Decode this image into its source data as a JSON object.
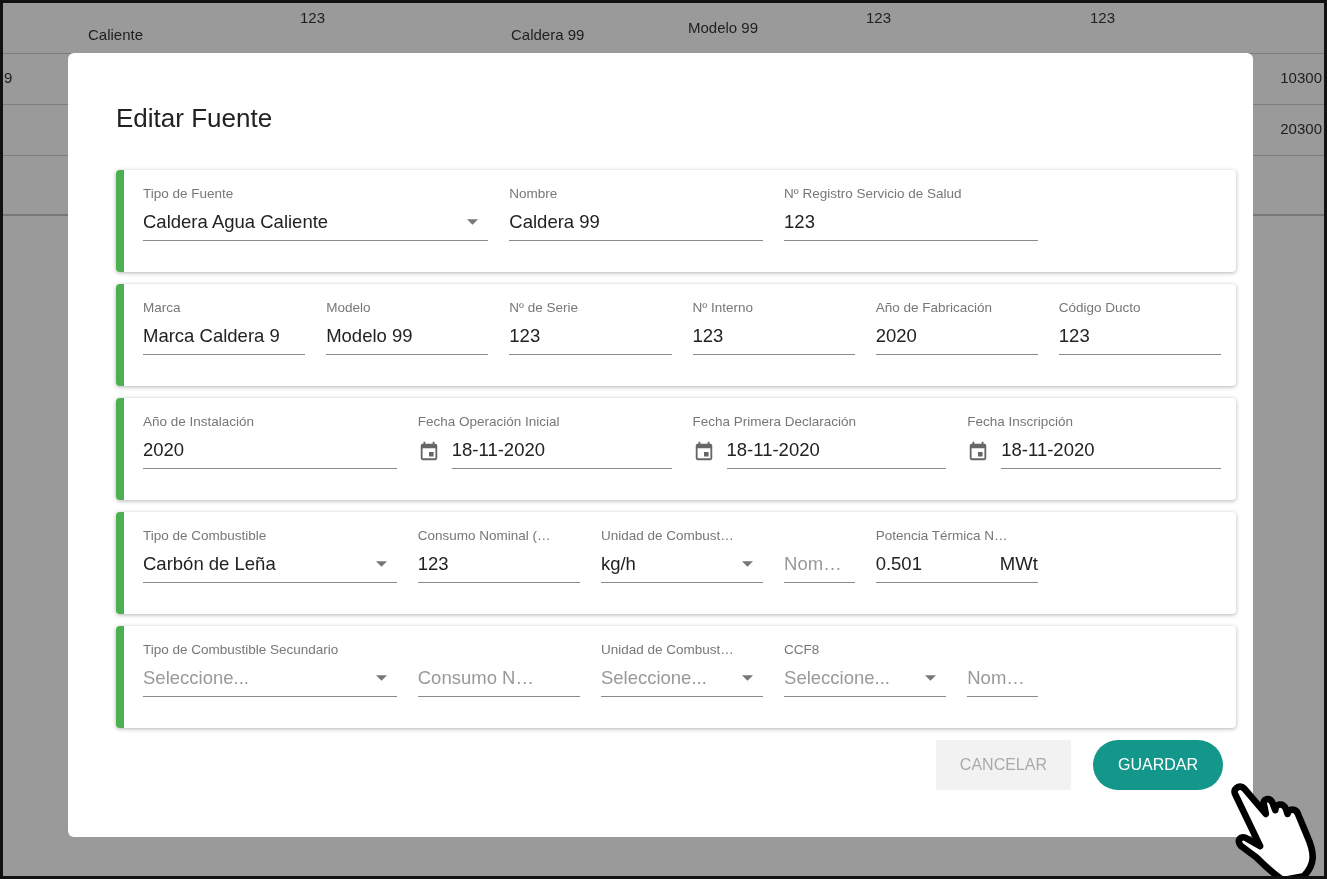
{
  "background_table": {
    "rows": [
      {
        "cells": [
          "Caliente",
          "123",
          "Caldera 99",
          "Modelo 99",
          "123",
          "123"
        ]
      },
      {
        "start": "9",
        "end": "10300"
      },
      {
        "end": "20300"
      },
      {}
    ]
  },
  "dialog": {
    "title": "Editar Fuente",
    "cards": [
      {
        "fields": [
          {
            "kind": "select",
            "label": "Tipo de Fuente",
            "value": "Caldera Agua Caliente"
          },
          {
            "kind": "text",
            "label": "Nombre",
            "value": "Caldera 99"
          },
          {
            "kind": "text",
            "label": "Nº Registro Servicio de Salud",
            "value": "123"
          }
        ]
      },
      {
        "fields": [
          {
            "kind": "text",
            "label": "Marca",
            "value": "Marca Caldera 9"
          },
          {
            "kind": "text",
            "label": "Modelo",
            "value": "Modelo 99"
          },
          {
            "kind": "text",
            "label": "Nº de Serie",
            "value": "123"
          },
          {
            "kind": "text",
            "label": "Nº Interno",
            "value": "123"
          },
          {
            "kind": "text",
            "label": "Año de Fabricación",
            "value": "2020"
          },
          {
            "kind": "text",
            "label": "Código Ducto",
            "value": "123"
          }
        ]
      },
      {
        "fields": [
          {
            "kind": "text",
            "label": "Año de Instalación",
            "value": "2020"
          },
          {
            "kind": "date",
            "label": "Fecha Operación Inicial",
            "value": "18-11-2020"
          },
          {
            "kind": "date",
            "label": "Fecha Primera Declaración",
            "value": "18-11-2020"
          },
          {
            "kind": "date",
            "label": "Fecha Inscripción",
            "value": "18-11-2020"
          }
        ]
      },
      {
        "fields": [
          {
            "kind": "select",
            "label": "Tipo de Combustible",
            "value": "Carbón de Leña"
          },
          {
            "kind": "text",
            "label": "Consumo Nominal (…",
            "value": "123"
          },
          {
            "kind": "select",
            "label": "Unidad de Combust…",
            "value": "kg/h"
          },
          {
            "kind": "text",
            "placeholder": "Nom…"
          },
          {
            "kind": "text",
            "label": "Potencia Térmica N…",
            "value": "0.501",
            "suffix": "MWt"
          }
        ]
      },
      {
        "fields": [
          {
            "kind": "select",
            "label": "Tipo de Combustible Secundario",
            "placeholder": "Seleccione..."
          },
          {
            "kind": "text",
            "placeholder": "Consumo N…"
          },
          {
            "kind": "select",
            "label": "Unidad de Combust…",
            "placeholder": "Seleccione..."
          },
          {
            "kind": "select",
            "label": "CCF8",
            "placeholder": "Seleccione..."
          },
          {
            "kind": "text",
            "placeholder": "Nom…"
          }
        ]
      }
    ],
    "buttons": [
      {
        "kind": "flat",
        "label": "CANCELAR",
        "disabled": true
      },
      {
        "kind": "primary",
        "label": "GUARDAR",
        "disabled": false
      }
    ]
  }
}
